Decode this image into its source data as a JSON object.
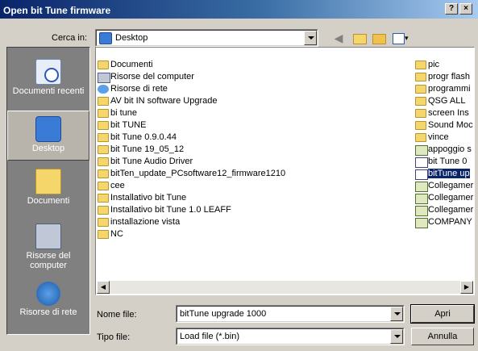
{
  "window": {
    "title": "Open bit Tune firmware",
    "help_label": "?",
    "close_label": "×"
  },
  "lookin": {
    "label": "Cerca in:",
    "value": "Desktop"
  },
  "places": [
    {
      "label": "Documenti recenti",
      "icon": "recent-documents-icon"
    },
    {
      "label": "Desktop",
      "icon": "desktop-icon",
      "selected": true
    },
    {
      "label": "Documenti",
      "icon": "documents-icon"
    },
    {
      "label": "Risorse del computer",
      "icon": "my-computer-icon"
    },
    {
      "label": "Risorse di rete",
      "icon": "network-icon"
    }
  ],
  "files_col1": [
    {
      "name": "Documenti",
      "icon": "documents-folder"
    },
    {
      "name": "Risorse del computer",
      "icon": "computer"
    },
    {
      "name": "Risorse di rete",
      "icon": "network"
    },
    {
      "name": "AV bit IN software Upgrade",
      "icon": "folder"
    },
    {
      "name": "bi tune",
      "icon": "folder"
    },
    {
      "name": "bit TUNE",
      "icon": "folder"
    },
    {
      "name": "bit Tune 0.9.0.44",
      "icon": "folder"
    },
    {
      "name": "bit Tune 19_05_12",
      "icon": "folder"
    },
    {
      "name": "bit Tune Audio Driver",
      "icon": "folder"
    },
    {
      "name": "bitTen_update_PCsoftware12_firmware1210",
      "icon": "folder"
    },
    {
      "name": "cee",
      "icon": "folder"
    },
    {
      "name": "Installativo bit Tune",
      "icon": "folder"
    },
    {
      "name": "Installativo bit Tune 1.0 LEAFF",
      "icon": "folder"
    },
    {
      "name": "installazione vista",
      "icon": "folder"
    },
    {
      "name": "NC",
      "icon": "folder"
    }
  ],
  "files_col2": [
    {
      "name": "pic",
      "icon": "folder"
    },
    {
      "name": "progr flash",
      "icon": "folder"
    },
    {
      "name": "programmi",
      "icon": "folder"
    },
    {
      "name": "QSG ALL",
      "icon": "folder"
    },
    {
      "name": "screen Ins",
      "icon": "folder"
    },
    {
      "name": "Sound Moc",
      "icon": "folder"
    },
    {
      "name": "vince",
      "icon": "folder"
    },
    {
      "name": "appoggio s",
      "icon": "shortcut"
    },
    {
      "name": "bit Tune 0",
      "icon": "bin-file"
    },
    {
      "name": "bitTune up",
      "icon": "bin-file",
      "selected": true
    },
    {
      "name": "Collegamer",
      "icon": "shortcut"
    },
    {
      "name": "Collegamer",
      "icon": "shortcut"
    },
    {
      "name": "Collegamer",
      "icon": "shortcut"
    },
    {
      "name": "COMPANY",
      "icon": "shortcut"
    }
  ],
  "filename": {
    "label": "Nome file:",
    "value": "bitTune upgrade 1000"
  },
  "filetype": {
    "label": "Tipo file:",
    "value": "Load file (*.bin)"
  },
  "buttons": {
    "open": "Apri",
    "cancel": "Annulla"
  }
}
